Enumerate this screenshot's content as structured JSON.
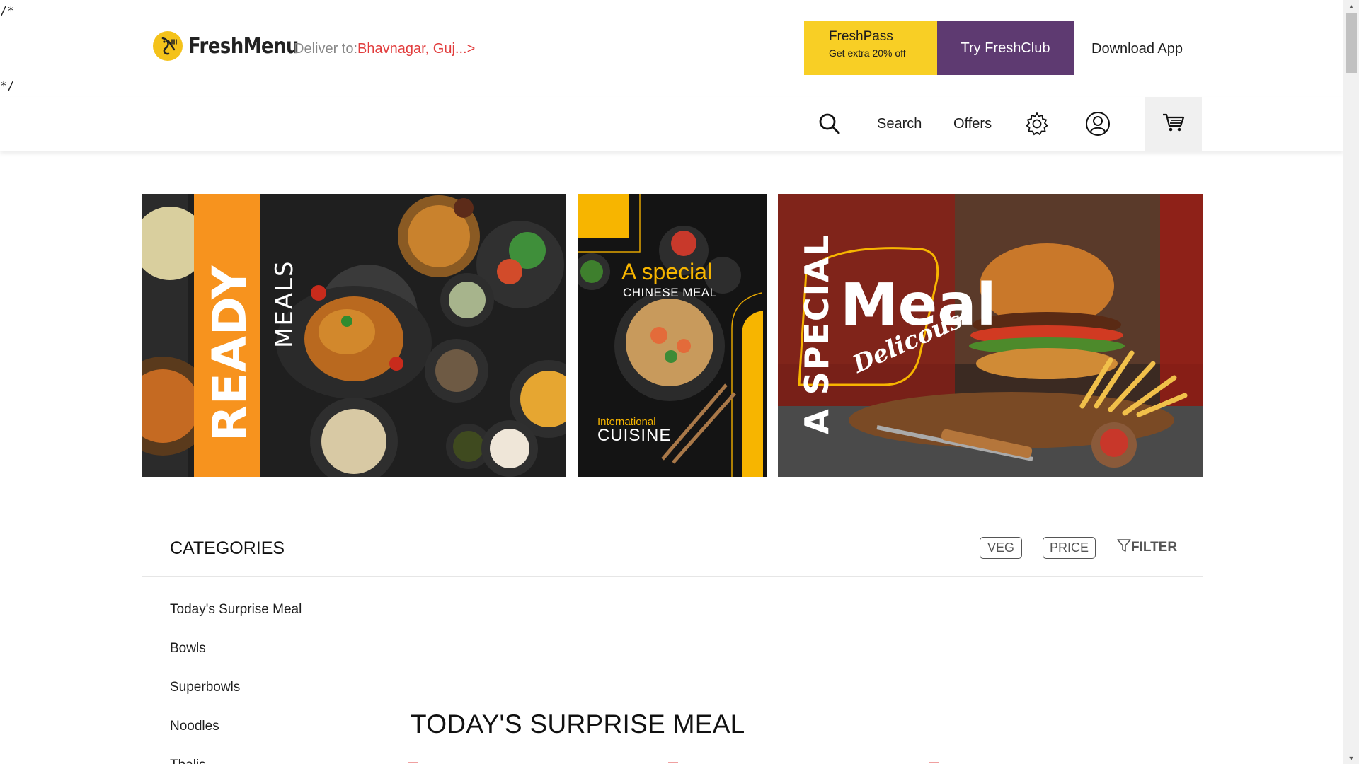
{
  "stray": {
    "open": "/*",
    "close": "*/"
  },
  "header": {
    "logo_text": "FreshMenu",
    "deliver_label": "Deliver to:",
    "deliver_location": "Bhavnagar, Guj...>",
    "freshpass_title": "FreshPass",
    "freshpass_sub": "Get extra 20% off",
    "freshclub_label": "Try FreshClub",
    "download_label": "Download App"
  },
  "nav": {
    "search_label": "Search",
    "offers_label": "Offers",
    "icons": [
      "search-icon",
      "gear-icon",
      "user-icon",
      "cart-icon"
    ]
  },
  "banners": [
    {
      "big": "READY",
      "small": "MEALS"
    },
    {
      "line1": "A special",
      "line2": "CHINESE MEAL",
      "line3": "International",
      "line4": "CUISINE"
    },
    {
      "vertical": "A SPECIAL",
      "big": "Meal",
      "script": "Delicous"
    }
  ],
  "categories": {
    "heading": "CATEGORIES",
    "chips": [
      "VEG",
      "PRICE"
    ],
    "filter_label": "FILTER",
    "items": [
      "Today's Surprise Meal",
      "Bowls",
      "Superbowls",
      "Noodles",
      "Thalis"
    ]
  },
  "section": {
    "title": "TODAY'S SURPRISE MEAL"
  },
  "colors": {
    "brand_yellow": "#f8cf25",
    "club_purple": "#5e3a71",
    "location_red": "#e13c3c",
    "banner_orange": "#f7931e"
  }
}
